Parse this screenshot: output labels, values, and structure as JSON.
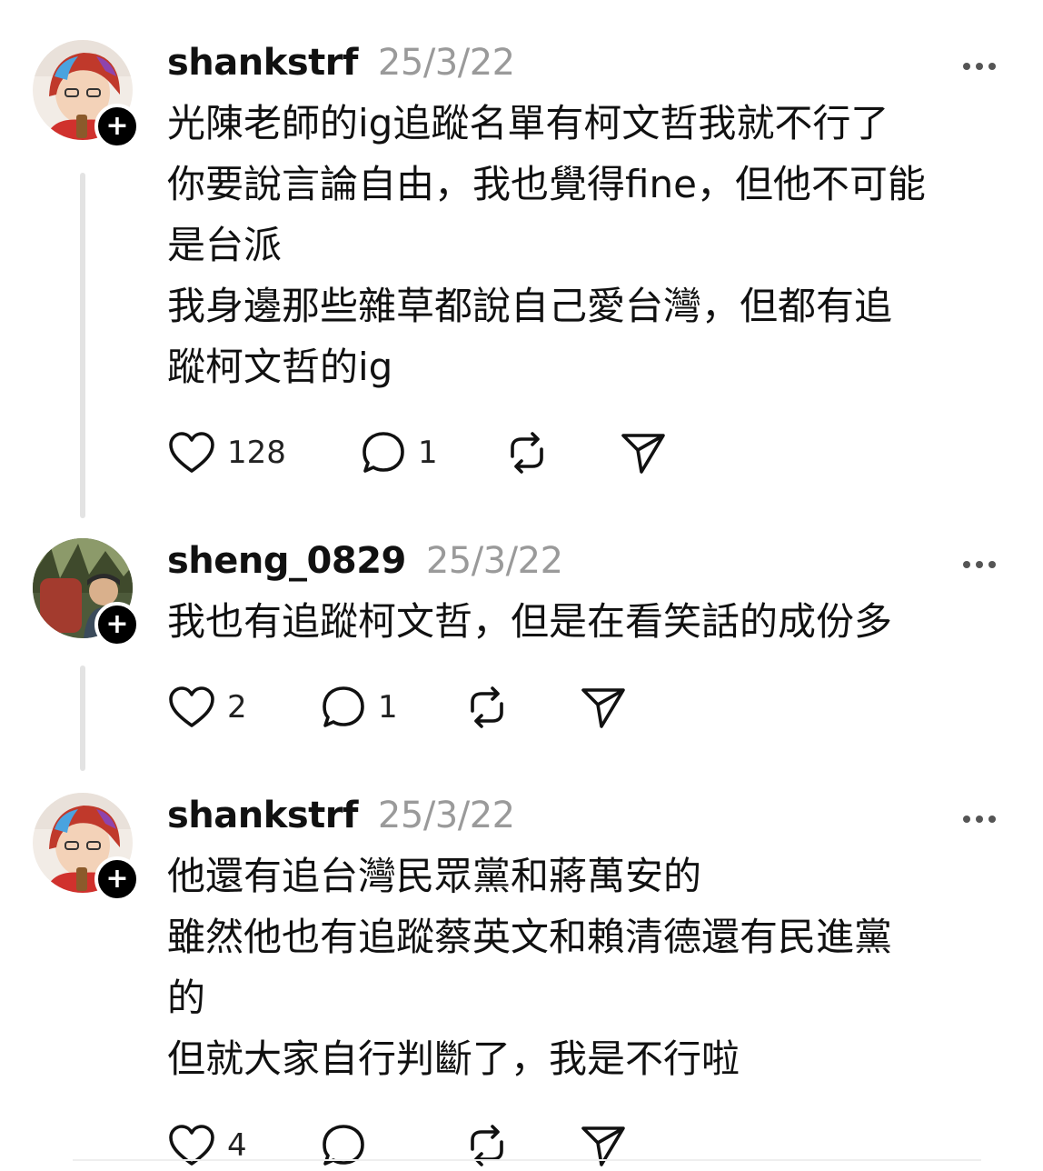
{
  "posts": [
    {
      "username": "shankstrf",
      "timestamp": "25/3/22",
      "lines": [
        "光陳老師的ig追蹤名單有柯文哲我就不行了",
        "你要說言論自由，我也覺得fine，但他不可能",
        "是台派",
        "我身邊那些雜草都說自己愛台灣，但都有追",
        "蹤柯文哲的ig"
      ],
      "likes": "128",
      "replies": "1",
      "reposts": "",
      "avatar": "avatar-red-hair"
    },
    {
      "username": "sheng_0829",
      "timestamp": "25/3/22",
      "lines": [
        "我也有追蹤柯文哲，但是在看笑話的成份多"
      ],
      "likes": "2",
      "replies": "1",
      "reposts": "",
      "avatar": "avatar-outdoor-hiker"
    },
    {
      "username": "shankstrf",
      "timestamp": "25/3/22",
      "lines": [
        "他還有追台灣民眾黨和蔣萬安的",
        "雖然他也有追蹤蔡英文和賴清德還有民進黨",
        "的",
        "但就大家自行判斷了，我是不行啦"
      ],
      "likes": "4",
      "replies": "",
      "reposts": "",
      "avatar": "avatar-red-hair"
    }
  ],
  "icons": {
    "follow": "plus-icon",
    "more": "more-options-icon",
    "like": "heart-icon",
    "reply": "comment-icon",
    "repost": "repost-icon",
    "share": "send-icon"
  },
  "colors": {
    "text": "#111111",
    "muted": "#9a9a9a",
    "thread_line": "#e3e3e3",
    "icon_stroke": "#111111"
  }
}
